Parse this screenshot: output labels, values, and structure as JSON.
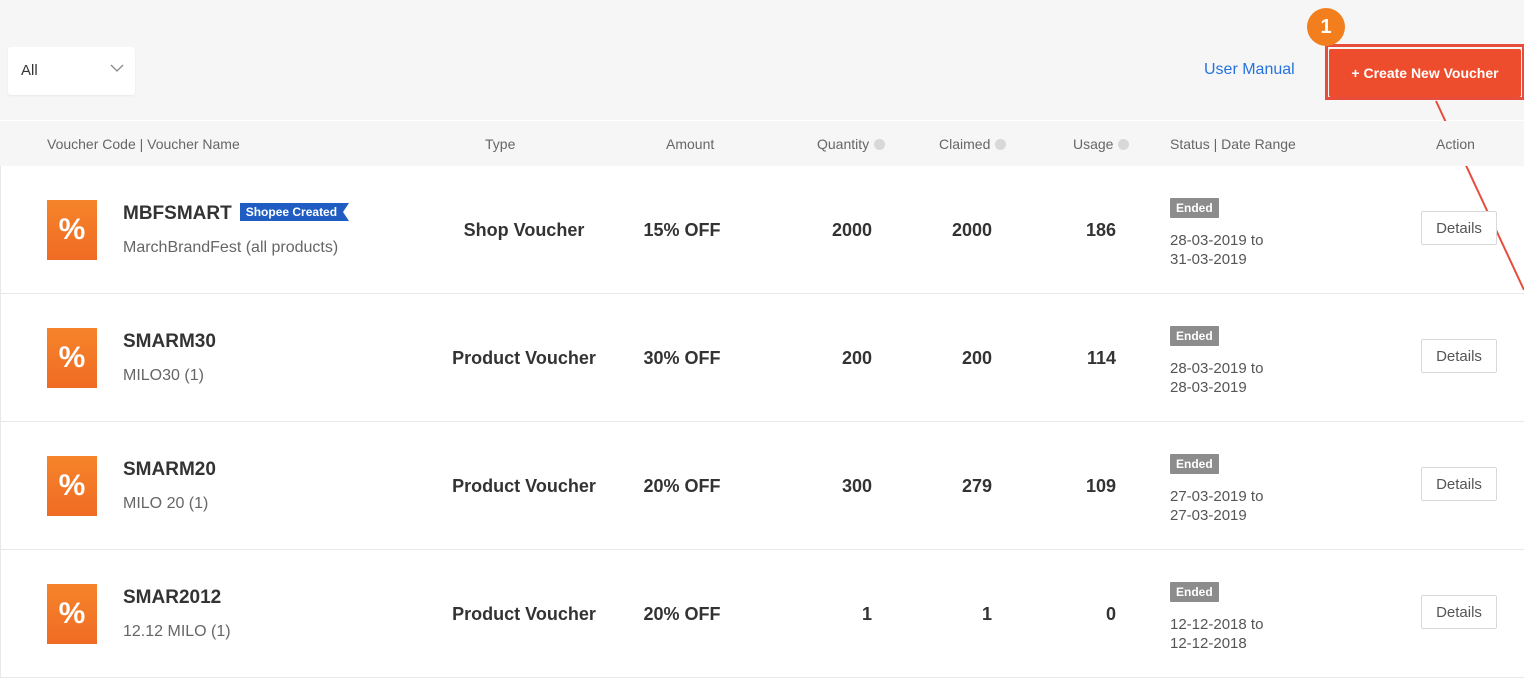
{
  "filter": {
    "value": "All"
  },
  "header": {
    "user_manual": "User Manual",
    "create_button": "+ Create New Voucher",
    "step_badge": "1"
  },
  "columns": {
    "code_name": "Voucher Code  |  Voucher Name",
    "type": "Type",
    "amount": "Amount",
    "quantity": "Quantity",
    "claimed": "Claimed",
    "usage": "Usage",
    "status_date": "Status  |  Date Range",
    "action": "Action"
  },
  "rows": [
    {
      "code": "MBFSMART",
      "badge": "Shopee Created",
      "name": "MarchBrandFest (all products)",
      "type": "Shop Voucher",
      "amount": "15% OFF",
      "quantity": "2000",
      "claimed": "2000",
      "usage": "186",
      "status": "Ended",
      "date_from": "28-03-2019 to",
      "date_to": "31-03-2019",
      "action": "Details"
    },
    {
      "code": "SMARM30",
      "name": "MILO30 (1)",
      "type": "Product Voucher",
      "amount": "30% OFF",
      "quantity": "200",
      "claimed": "200",
      "usage": "114",
      "status": "Ended",
      "date_from": "28-03-2019 to",
      "date_to": "28-03-2019",
      "action": "Details"
    },
    {
      "code": "SMARM20",
      "name": "MILO 20 (1)",
      "type": "Product Voucher",
      "amount": "20% OFF",
      "quantity": "300",
      "claimed": "279",
      "usage": "109",
      "status": "Ended",
      "date_from": "27-03-2019 to",
      "date_to": "27-03-2019",
      "action": "Details"
    },
    {
      "code": "SMAR2012",
      "name": "12.12 MILO (1)",
      "type": "Product Voucher",
      "amount": "20% OFF",
      "quantity": "1",
      "claimed": "1",
      "usage": "0",
      "status": "Ended",
      "date_from": "12-12-2018 to",
      "date_to": "12-12-2018",
      "action": "Details"
    }
  ],
  "icons": {
    "voucher": "percent-icon",
    "dropdown": "chevron-down-icon",
    "info": "info-icon"
  },
  "colors": {
    "brand": "#ee4d2d",
    "badge_blue": "#1f5dc3",
    "status_ended": "#8c8c8c",
    "link": "#2673dd",
    "callout": "#f37e1e"
  }
}
